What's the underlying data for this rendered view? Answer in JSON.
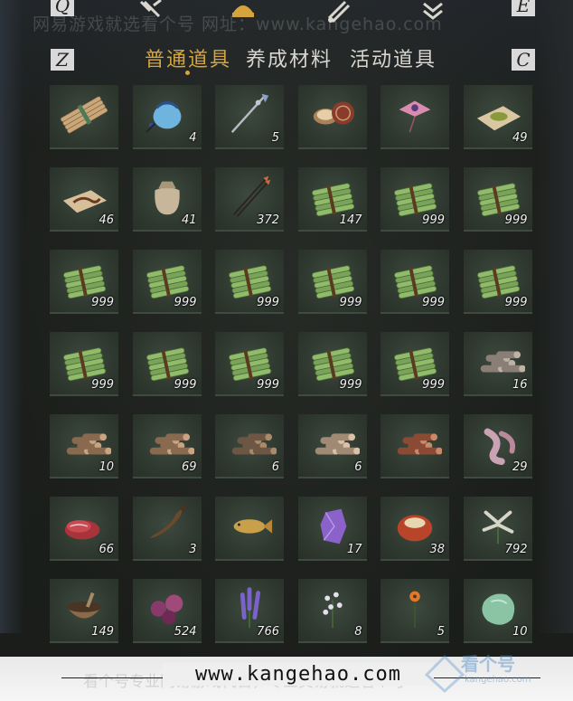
{
  "keys": {
    "q": "Q",
    "e": "E",
    "z": "Z",
    "c": "C"
  },
  "watermark_top": "网易游戏就选看个号    网址：www.kangehao.com",
  "top_icons": [
    "hammer-icon",
    "inventory-bag-icon",
    "scroll-icon",
    "chevron-rank-icon"
  ],
  "tabs": [
    {
      "label": "普通道具",
      "active": true
    },
    {
      "label": "养成材料",
      "active": false
    },
    {
      "label": "活动道具",
      "active": false
    }
  ],
  "items": [
    {
      "name": "bamboo-scroll-bundle",
      "count": ""
    },
    {
      "name": "blue-pouch",
      "count": "4"
    },
    {
      "name": "ornate-spear",
      "count": "5"
    },
    {
      "name": "rouge-box",
      "count": ""
    },
    {
      "name": "pink-kite",
      "count": ""
    },
    {
      "name": "green-powder-paper",
      "count": "49"
    },
    {
      "name": "worm-on-paper",
      "count": "46"
    },
    {
      "name": "cloth-sack",
      "count": "41"
    },
    {
      "name": "arrows",
      "count": "372"
    },
    {
      "name": "bamboo-bundle",
      "count": "147"
    },
    {
      "name": "bamboo-bundle",
      "count": "999"
    },
    {
      "name": "bamboo-bundle",
      "count": "999"
    },
    {
      "name": "bamboo-bundle",
      "count": "999"
    },
    {
      "name": "bamboo-bundle",
      "count": "999"
    },
    {
      "name": "bamboo-bundle",
      "count": "999"
    },
    {
      "name": "bamboo-bundle",
      "count": "999"
    },
    {
      "name": "bamboo-bundle",
      "count": "999"
    },
    {
      "name": "bamboo-bundle",
      "count": "999"
    },
    {
      "name": "bamboo-bundle",
      "count": "999"
    },
    {
      "name": "bamboo-bundle",
      "count": "999"
    },
    {
      "name": "bamboo-bundle",
      "count": "999"
    },
    {
      "name": "bamboo-bundle",
      "count": "999"
    },
    {
      "name": "bamboo-bundle",
      "count": "999"
    },
    {
      "name": "gray-wood-logs",
      "count": "16"
    },
    {
      "name": "wood-logs",
      "count": "10"
    },
    {
      "name": "wood-logs",
      "count": "69"
    },
    {
      "name": "dark-wood-logs",
      "count": "6"
    },
    {
      "name": "pale-wood-logs",
      "count": "6"
    },
    {
      "name": "red-wood-logs",
      "count": ""
    },
    {
      "name": "pink-root",
      "count": "29"
    },
    {
      "name": "raw-meat",
      "count": "66"
    },
    {
      "name": "dark-fish",
      "count": "3"
    },
    {
      "name": "golden-carp",
      "count": ""
    },
    {
      "name": "purple-crystal",
      "count": "17"
    },
    {
      "name": "red-agate",
      "count": "38"
    },
    {
      "name": "white-herb",
      "count": "792"
    },
    {
      "name": "herb-mortar",
      "count": "149"
    },
    {
      "name": "purple-flowers",
      "count": "524"
    },
    {
      "name": "lavender-herb",
      "count": "766"
    },
    {
      "name": "white-blossom",
      "count": "8"
    },
    {
      "name": "orange-flower",
      "count": "5"
    },
    {
      "name": "jade-stone",
      "count": "10"
    }
  ],
  "bottom": {
    "url": "www.kangehao.com",
    "watermark": "看个号专业网易游戏代售，专业交易就选看个号",
    "logo_main": "看个号",
    "logo_sub": "kangehao.com"
  },
  "colors": {
    "accent": "#d6a43c",
    "cell_bg": "#303a31",
    "text": "#f2f2f2"
  }
}
